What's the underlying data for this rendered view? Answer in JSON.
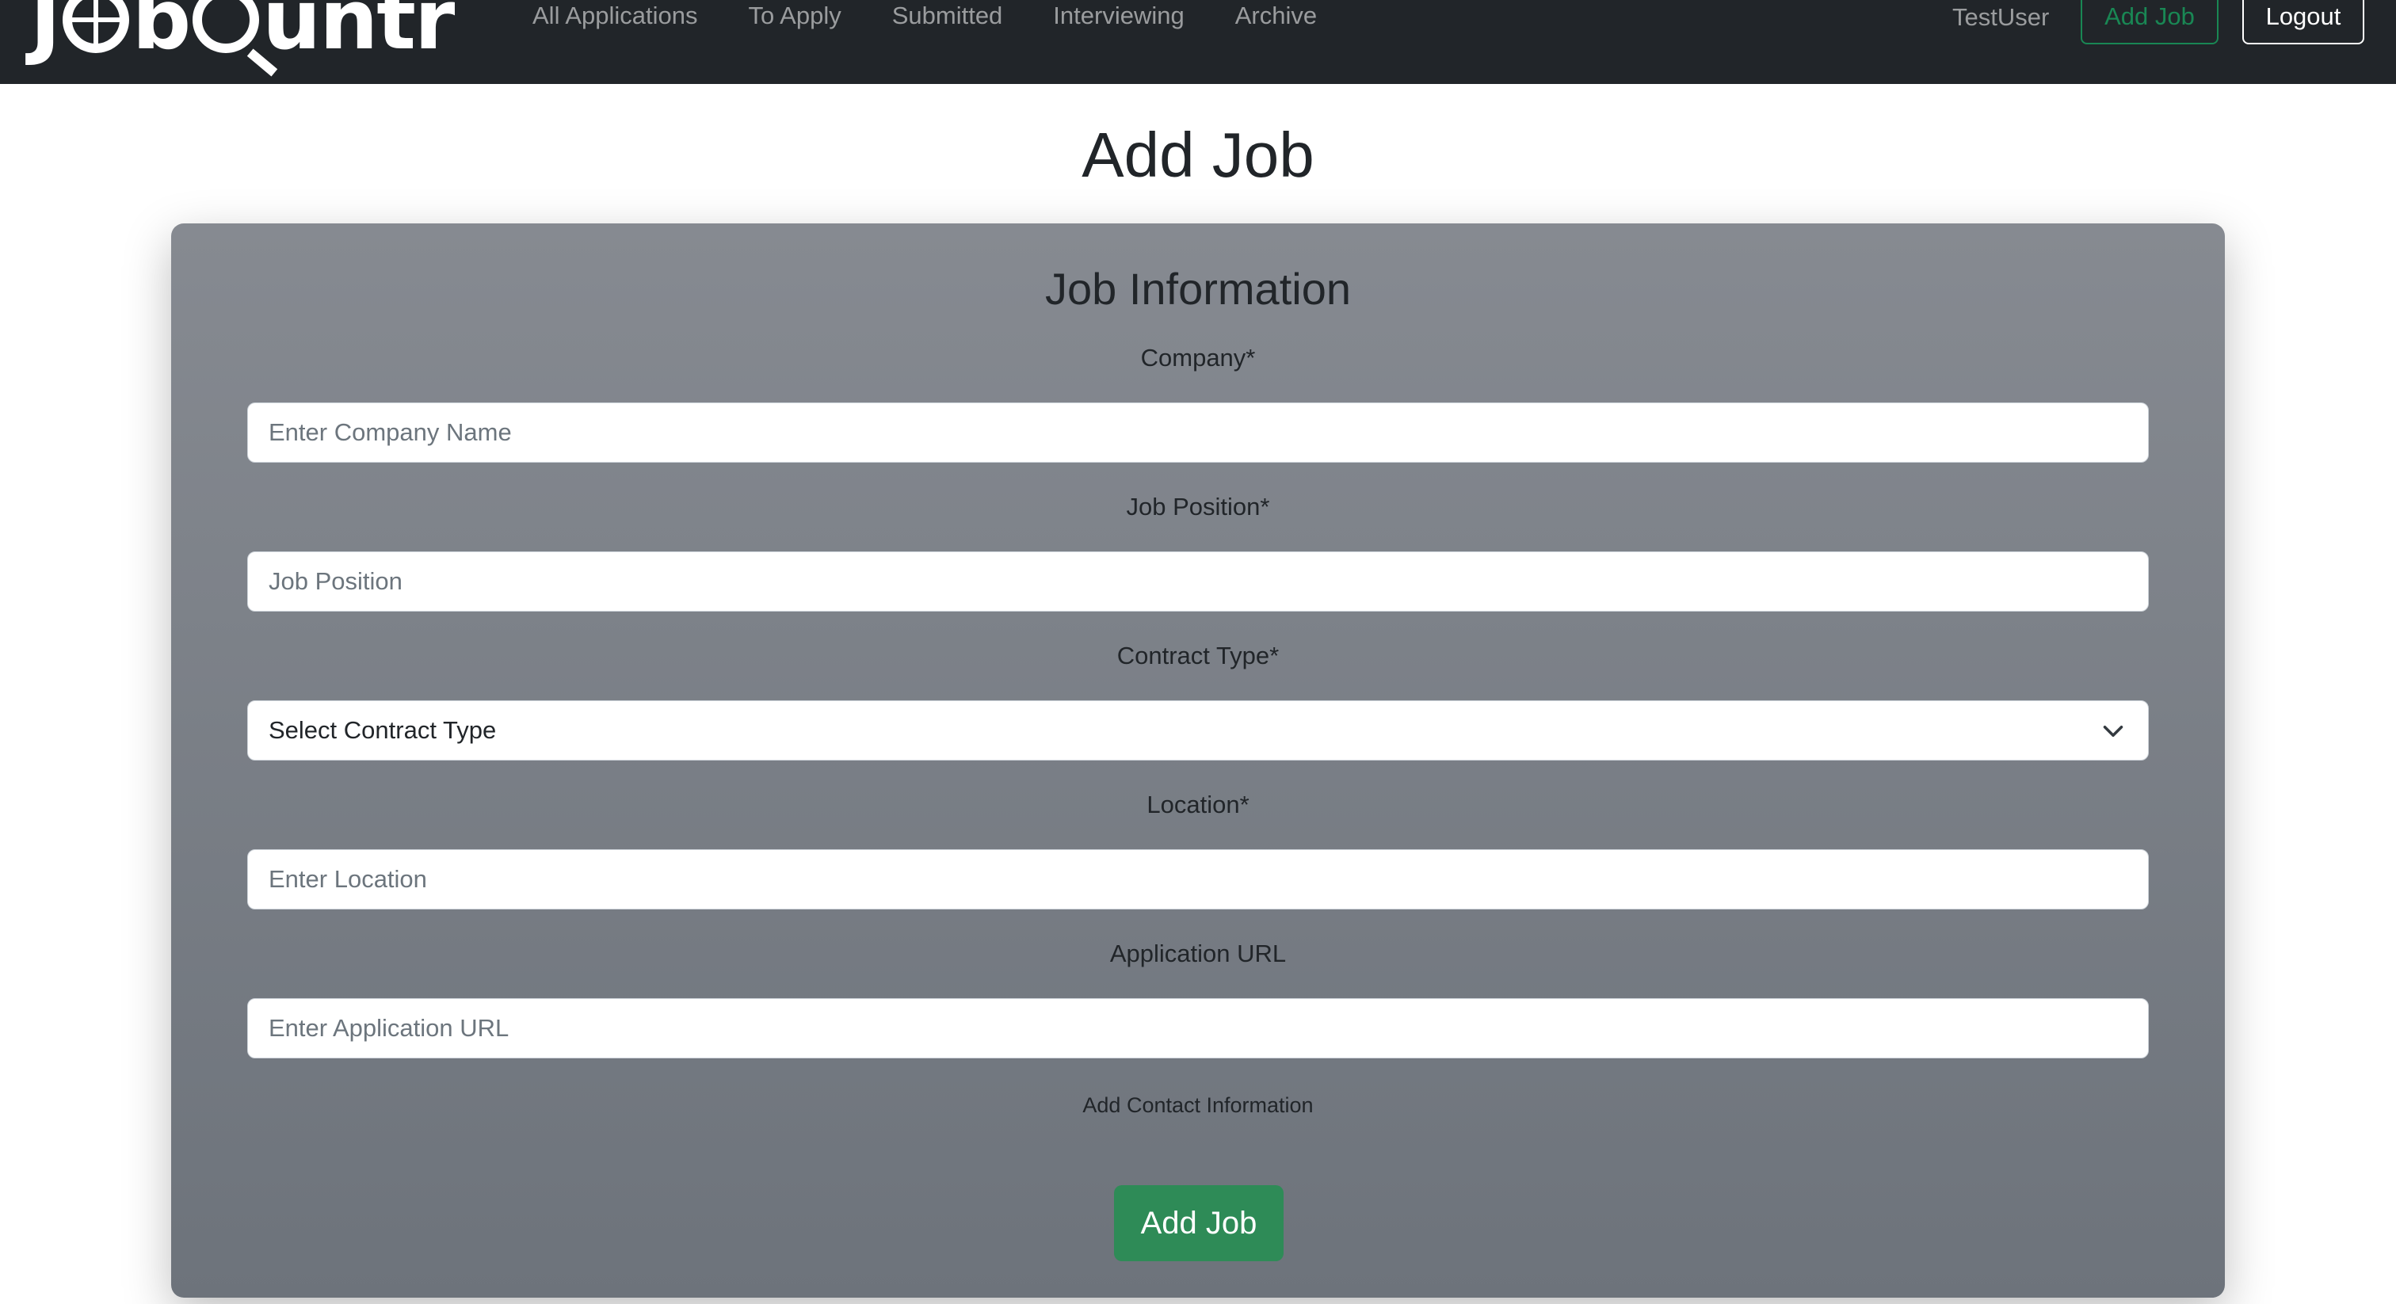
{
  "navbar": {
    "logo_text": "JobHuntr",
    "links": [
      "All Applications",
      "To Apply",
      "Submitted",
      "Interviewing",
      "Archive"
    ],
    "username": "TestUser",
    "add_job_label": "Add Job",
    "logout_label": "Logout"
  },
  "page": {
    "title": "Add Job"
  },
  "form": {
    "title": "Job Information",
    "company": {
      "label": "Company*",
      "placeholder": "Enter Company Name"
    },
    "position": {
      "label": "Job Position*",
      "placeholder": "Job Position"
    },
    "contract": {
      "label": "Contract Type*",
      "selected": "Select Contract Type"
    },
    "location": {
      "label": "Location*",
      "placeholder": "Enter Location"
    },
    "url": {
      "label": "Application URL",
      "placeholder": "Enter Application URL"
    },
    "contact_link": "Add Contact Information",
    "submit_label": "Add Job"
  },
  "colors": {
    "navbar_bg": "#212529",
    "accent_green": "#198754",
    "submit_green": "#2e8b57",
    "card_bg": "#7a7f87"
  }
}
